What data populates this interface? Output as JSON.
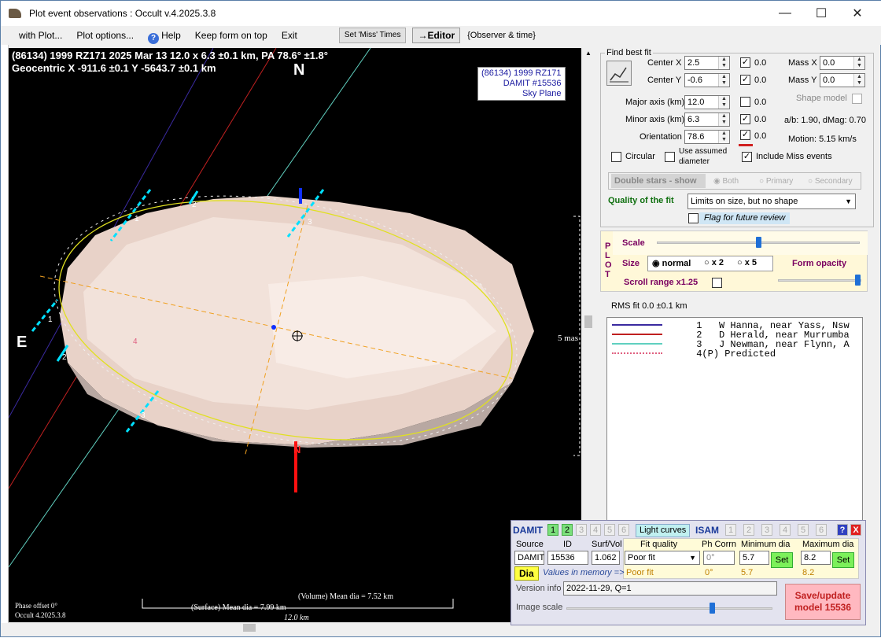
{
  "window": {
    "title": "Plot event observations : Occult v.4.2025.3.8"
  },
  "menu": {
    "with_plot": "with Plot...",
    "plot_options": "Plot options...",
    "help": "Help",
    "keep_form": "Keep form on top",
    "exit": "Exit",
    "set_miss": "Set 'Miss' Times",
    "editor": "→Editor",
    "observer_time": "{Observer & time}"
  },
  "plot": {
    "line1": "(86134) 1999 RZ171  2025 Mar 13  12.0 x 6.3 ±0.1 km, PA 78.6° ±1.8°",
    "line2": "Geocentric  X  -911.6 ±0.1  Y -5643.7 ±0.1 km",
    "north": "N",
    "east": "E",
    "north_small": "N",
    "info1": "(86134) 1999 RZ171",
    "info2": "DAMIT #15536",
    "info3": "Sky Plane",
    "scale_label": "5 mas",
    "chord_labels": [
      "1",
      "2",
      "3",
      "1",
      "2",
      "3",
      "4"
    ],
    "vol_dia": "(Volume) Mean dia = 7.52 km",
    "surf_dia": "(Surface) Mean dia = 7.99 km",
    "axis_len": "12.0 km",
    "phase": "Phase offset 0°",
    "version": "Occult 4.2025.3.8",
    "colors": {
      "chord1": "#3a2aa0",
      "chord2": "#c02020",
      "chord3": "#60d0c0",
      "ellipse": "#e0e020",
      "dash": "#f0a020",
      "cyan": "#00e0ff"
    }
  },
  "fit": {
    "group": "Find best fit",
    "center_x_label": "Center X",
    "center_x": "2.5",
    "center_x_err": "0.0",
    "center_y_label": "Center Y",
    "center_y": "-0.6",
    "center_y_err": "0.0",
    "major_label": "Major axis (km)",
    "major": "12.0",
    "major_err": "0.0",
    "minor_label": "Minor axis (km)",
    "minor": "6.3",
    "minor_err": "0.0",
    "orient_label": "Orientation",
    "orient": "78.6",
    "orient_err": "0.0",
    "massx_label": "Mass X",
    "massx": "0.0",
    "massy_label": "Mass Y",
    "massy": "0.0",
    "shape_model": "Shape model",
    "ab": "a/b: 1.90, dMag: 0.70",
    "motion": "Motion: 5.15 km/s",
    "circular": "Circular",
    "use_assumed": "Use assumed",
    "diameter": "diameter",
    "include_miss": "Include Miss events",
    "double_stars": "Double stars - show",
    "both": "Both",
    "primary": "Primary",
    "secondary": "Secondary",
    "quality_label": "Quality of the fit",
    "quality_value": "Limits on size, but no shape",
    "flag": "Flag for future review"
  },
  "plotpanel": {
    "plot_letters": [
      "P",
      "L",
      "O",
      "T"
    ],
    "scale": "Scale",
    "size": "Size",
    "normal": "normal",
    "x2": "x 2",
    "x5": "x 5",
    "form_opacity": "Form opacity",
    "scroll_range": "Scroll range x1.25",
    "rms": "RMS fit 0.0 ±0.1 km"
  },
  "observers": [
    {
      "num": "1",
      "name": "W Hanna, near Yass, Nsw",
      "color": "#3a2aa0"
    },
    {
      "num": "2",
      "name": "D Herald, near Murrumba",
      "color": "#c02020"
    },
    {
      "num": "3",
      "name": "J Newman, near Flynn, A",
      "color": "#60d0c0"
    },
    {
      "num": "4(P)",
      "name": "Predicted",
      "color": "#e06080"
    }
  ],
  "damit": {
    "damit_label": "DAMIT",
    "nums": [
      "1",
      "2",
      "3",
      "4",
      "5",
      "6"
    ],
    "light_curves": "Light curves",
    "isam_label": "ISAM",
    "isam_nums": [
      "1",
      "2",
      "3",
      "4",
      "5",
      "6"
    ],
    "help": "?",
    "close": "X",
    "source_h": "Source",
    "id_h": "ID",
    "surf_h": "Surf/Vol",
    "source": "DAMIT",
    "id": "15536",
    "surf": "1.062",
    "fitq_h": "Fit quality",
    "phcorr_h": "Ph Corrn",
    "mindia_h": "Minimum dia",
    "maxdia_h": "Maximum dia",
    "fitq": "Poor fit",
    "phcorr": "0°",
    "mindia": "5.7",
    "maxdia": "8.2",
    "set": "Set",
    "dia": "Dia",
    "values_mem": "Values in memory =>",
    "mem_fitq": "Poor fit",
    "mem_ph": "0°",
    "mem_min": "5.7",
    "mem_max": "8.2",
    "version_label": "Version info",
    "version_value": "2022-11-29, Q=1",
    "image_scale": "Image scale",
    "save": "Save/update",
    "save2": "model  15536"
  }
}
